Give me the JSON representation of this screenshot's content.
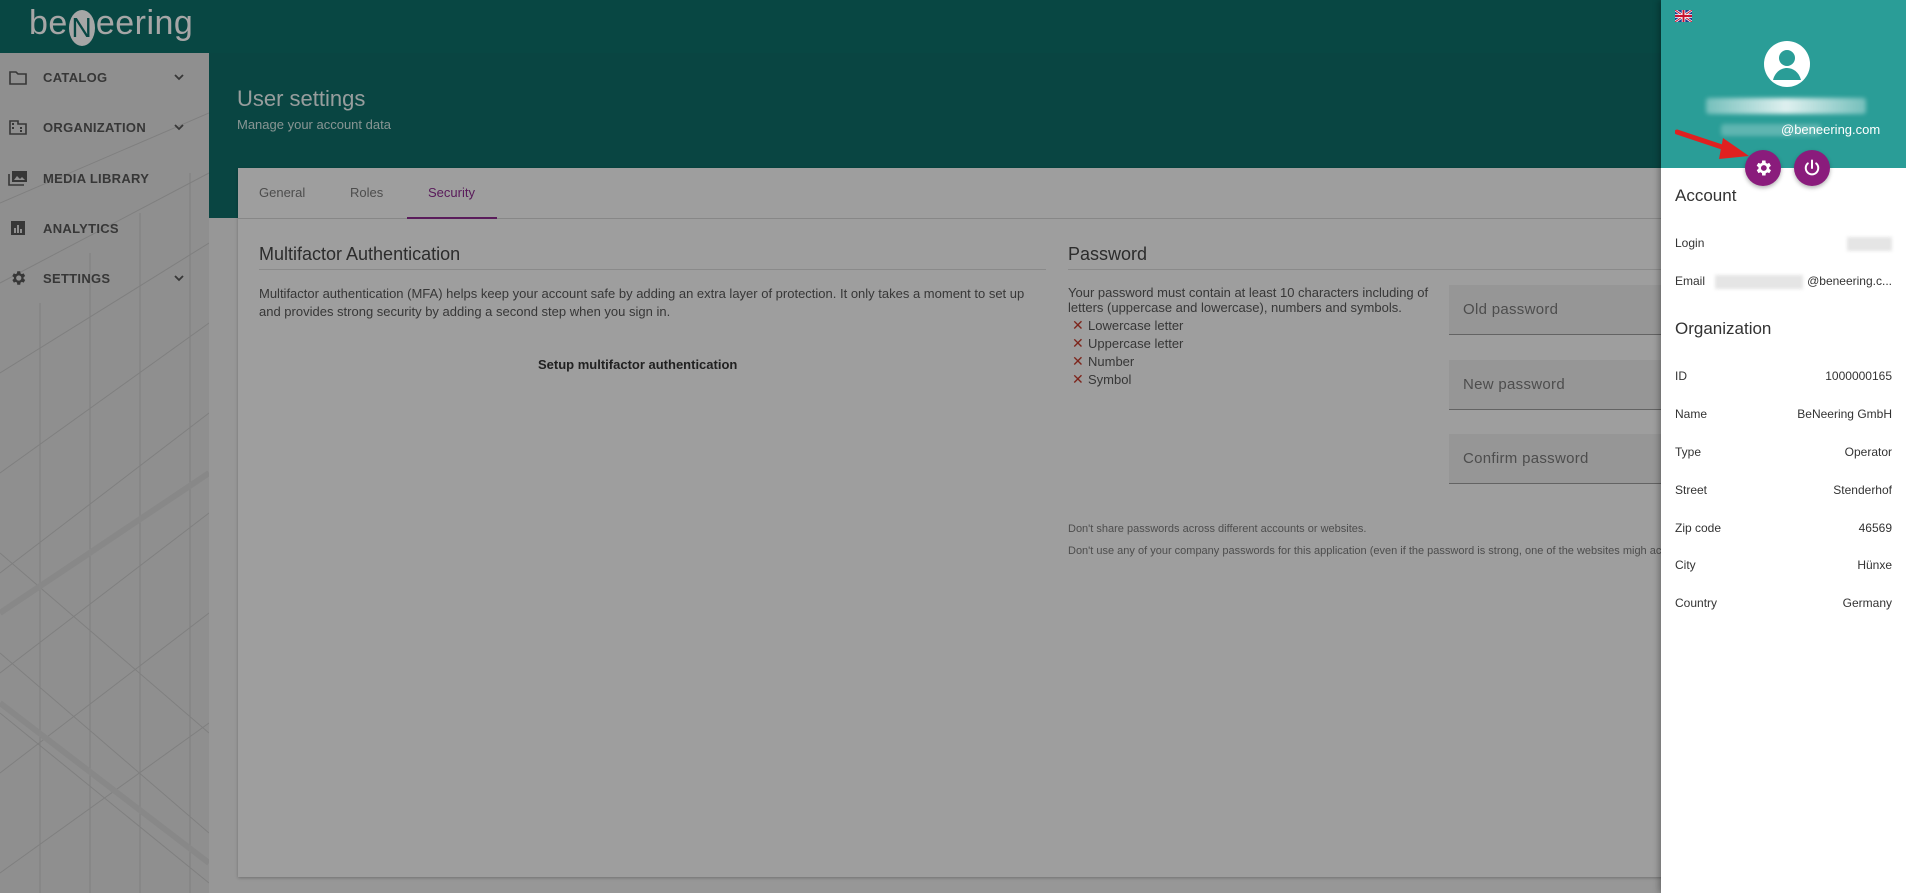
{
  "app": {
    "logo_left": "be",
    "logo_mid": "N",
    "logo_right": "eering"
  },
  "sidebar": {
    "items": [
      {
        "label": "CATALOG",
        "icon": "folder-icon",
        "expandable": true
      },
      {
        "label": "ORGANIZATION",
        "icon": "building-icon",
        "expandable": true
      },
      {
        "label": "MEDIA LIBRARY",
        "icon": "image-library-icon",
        "expandable": false
      },
      {
        "label": "ANALYTICS",
        "icon": "chart-icon",
        "expandable": false
      },
      {
        "label": "SETTINGS",
        "icon": "gear-icon",
        "expandable": true
      }
    ]
  },
  "page": {
    "title": "User settings",
    "subtitle": "Manage your account data"
  },
  "tabs": [
    {
      "label": "General"
    },
    {
      "label": "Roles"
    },
    {
      "label": "Security"
    }
  ],
  "active_tab": "Security",
  "mfa": {
    "title": "Multifactor Authentication",
    "text": "Multifactor authentication (MFA) helps keep your account safe by adding an extra layer of protection. It only takes a moment to set up and provides strong security by adding a second step when you sign in.",
    "button": "Setup multifactor authentication"
  },
  "password": {
    "title": "Password",
    "requirements_text": "Your password must contain at least 10 characters including of letters (uppercase and lowercase), numbers and symbols.",
    "rules": [
      "Lowercase letter",
      "Uppercase letter",
      "Number",
      "Symbol"
    ],
    "fields": [
      {
        "placeholder": "Old password"
      },
      {
        "placeholder": "New password"
      },
      {
        "placeholder": "Confirm password"
      }
    ],
    "note1": "Don't share passwords across different accounts or websites.",
    "note2": "Don't use any of your company passwords for this application (even if the password is strong, one of the websites migh accounts in danger)."
  },
  "drawer": {
    "email_suffix": "@beneering.com",
    "account": {
      "title": "Account",
      "login_label": "Login",
      "email_label": "Email",
      "email_value": "@beneering.c..."
    },
    "organization": {
      "title": "Organization",
      "rows": [
        {
          "key": "ID",
          "value": "1000000165"
        },
        {
          "key": "Name",
          "value": "BeNeering GmbH"
        },
        {
          "key": "Type",
          "value": "Operator"
        },
        {
          "key": "Street",
          "value": "Stenderhof"
        },
        {
          "key": "Zip code",
          "value": "46569"
        },
        {
          "key": "City",
          "value": "Hünxe"
        },
        {
          "key": "Country",
          "value": "Germany"
        }
      ]
    }
  },
  "colors": {
    "header": "#0d6e68",
    "drawer_header": "#2a9d97",
    "accent": "#8a2c8c",
    "button": "#8a1c7c",
    "arrow": "#e02020"
  }
}
